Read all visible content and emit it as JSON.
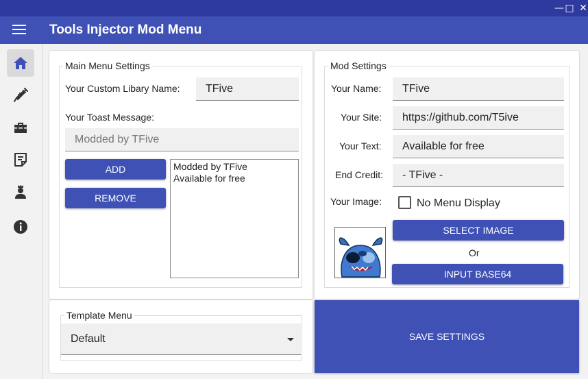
{
  "window": {
    "controls": {
      "minimize": "—",
      "maximize": "□",
      "close": "✕"
    }
  },
  "header": {
    "title": "Tools Injector Mod Menu",
    "menu_icon": "hamburger-icon"
  },
  "sidebar": {
    "items": [
      {
        "icon": "home-icon",
        "active": true
      },
      {
        "icon": "syringe-icon",
        "active": false
      },
      {
        "icon": "toolbox-icon",
        "active": false
      },
      {
        "icon": "note-icon",
        "active": false
      },
      {
        "icon": "user-crown-icon",
        "active": false
      },
      {
        "icon": "info-icon",
        "active": false
      }
    ]
  },
  "main_menu": {
    "legend": "Main Menu Settings",
    "library_label": "Your Custom Libary Name:",
    "library_value": "TFive",
    "toast_label": "Your Toast Message:",
    "toast_placeholder": "Modded by TFive",
    "add_label": "ADD",
    "remove_label": "REMOVE",
    "toasts": [
      "Modded by TFive",
      "Available for free"
    ]
  },
  "mod_settings": {
    "legend": "Mod Settings",
    "name_label": "Your Name:",
    "name_value": "TFive",
    "site_label": "Your Site:",
    "site_value": "https://github.com/T5ive",
    "text_label": "Your Text:",
    "text_value": "Available for free",
    "credit_label": "End Credit:",
    "credit_value": "- TFive -",
    "image_label": "Your Image:",
    "no_menu_label": "No Menu Display",
    "no_menu_checked": false,
    "select_image_label": "SELECT IMAGE",
    "or_label": "Or",
    "base64_label": "INPUT BASE64"
  },
  "template": {
    "legend": "Template Menu",
    "selected": "Default"
  },
  "save_label": "SAVE SETTINGS",
  "colors": {
    "accent": "#3f51b5",
    "titlebar": "#2e3a9e"
  }
}
